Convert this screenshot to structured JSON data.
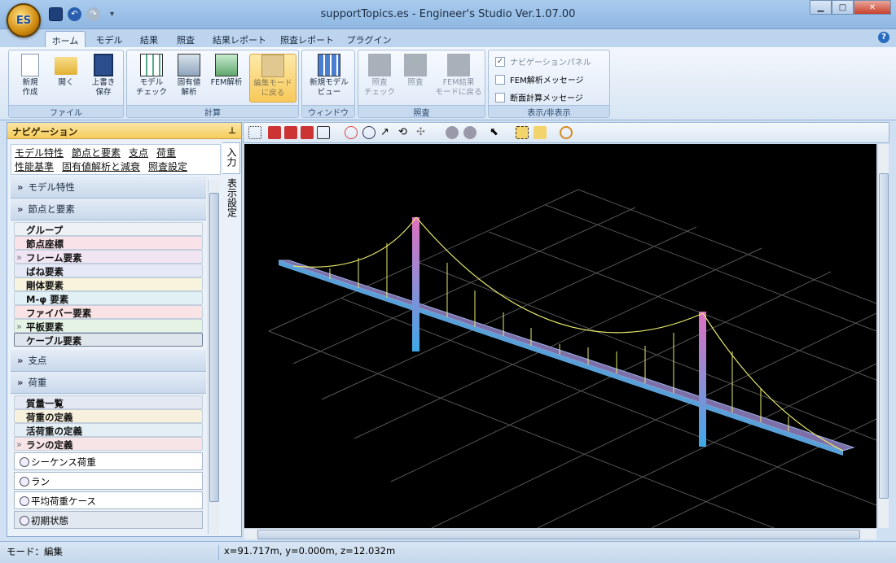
{
  "window": {
    "title": "supportTopics.es - Engineer's Studio Ver.1.07.00",
    "orb_text": "ES"
  },
  "tabs": [
    "ホーム",
    "モデル",
    "結果",
    "照査",
    "結果レポート",
    "照査レポート",
    "プラグイン"
  ],
  "ribbon": {
    "file": {
      "label": "ファイル",
      "buttons": [
        "新規\n作成",
        "開く",
        "上書き\n保存"
      ]
    },
    "calc": {
      "label": "計算",
      "buttons": [
        "モデル\nチェック",
        "固有値\n解析",
        "FEM解析",
        "編集モード\nに戻る"
      ]
    },
    "window_group": {
      "label": "ウィンドウ",
      "buttons": [
        "新規モデル\nビュー"
      ]
    },
    "check": {
      "label": "照査",
      "buttons": [
        "照査\nチェック",
        "照査",
        "FEM結果\nモードに戻る"
      ]
    },
    "display": {
      "label": "表示/非表示",
      "items": [
        {
          "label": "ナビゲーションパネル",
          "checked": true
        },
        {
          "label": "FEM解析メッセージ",
          "checked": false
        },
        {
          "label": "断面計算メッセージ",
          "checked": false
        }
      ]
    }
  },
  "nav": {
    "title": "ナビゲーション",
    "links": [
      "モデル特性",
      "節点と要素",
      "支点",
      "荷重",
      "性能基準",
      "固有値解析と減衰",
      "照査設定"
    ],
    "vtabs": [
      "入力",
      "表示設定"
    ],
    "sections": {
      "model": "モデル特性",
      "nodes": "節点と要素",
      "node_items": [
        "グループ",
        "節点座標",
        "フレーム要素",
        "ばね要素",
        "剛体要素",
        "M-φ 要素",
        "ファイバー要素",
        "平板要素",
        "ケーブル要素"
      ],
      "support": "支点",
      "load": "荷重",
      "load_items": [
        "質量一覧",
        "荷重の定義",
        "活荷重の定義",
        "ランの定義"
      ],
      "load_plain": [
        "シーケンス荷重",
        "ラン",
        "平均荷重ケース",
        "初期状態"
      ]
    }
  },
  "status": {
    "mode": "モード：編集",
    "coords": "x=91.717m, y=0.000m, z=12.032m"
  },
  "colors": {
    "accent": "#f6cc5c",
    "viewport_bg": "#000000",
    "grid": "#4a4a4a",
    "deck": "#7d6fa8",
    "cable": "#e8e86a",
    "tower": "#c060c0"
  }
}
